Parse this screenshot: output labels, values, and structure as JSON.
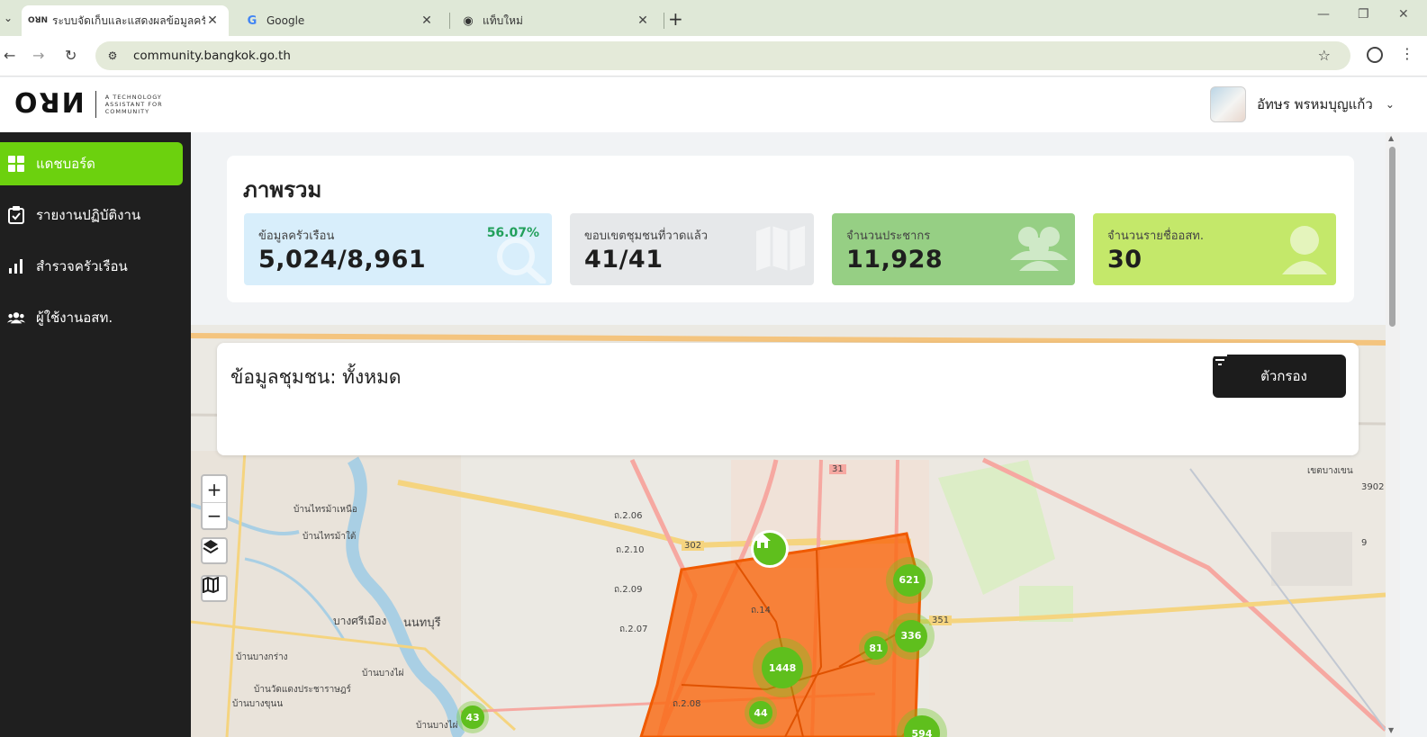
{
  "browser": {
    "tabs": [
      {
        "title": "ระบบจัดเก็บและแสดงผลข้อมูลครัวเรือน",
        "favicon": "OꓤN",
        "active": true
      },
      {
        "title": "Google",
        "favicon": "G",
        "active": false
      },
      {
        "title": "แท็บใหม่",
        "favicon": "◉",
        "active": false
      }
    ],
    "url": "community.bangkok.go.th",
    "new_tab": "+",
    "controls": {
      "minimize": "—",
      "restore": "❐",
      "close": "✕"
    }
  },
  "header": {
    "logo_mark": "OꓤИ",
    "logo_tagline": [
      "A TECHNOLOGY",
      "ASSISTANT FOR",
      "COMMUNITY"
    ],
    "user_name": "อัทษร พรหมบุญแก้ว"
  },
  "sidebar": {
    "items": [
      {
        "label": "แดชบอร์ด",
        "icon": "dashboard-icon",
        "active": true
      },
      {
        "label": "รายงานปฏิบัติงาน",
        "icon": "clipboard-check-icon",
        "active": false
      },
      {
        "label": "สำรวจครัวเรือน",
        "icon": "bar-chart-icon",
        "active": false
      },
      {
        "label": "ผู้ใช้งานอสท.",
        "icon": "users-icon",
        "active": false
      }
    ]
  },
  "overview": {
    "title": "ภาพรวม",
    "stats": [
      {
        "label": "ข้อมูลครัวเรือน",
        "value": "5,024/8,961",
        "percent": "56.07%",
        "color": "#d8eefb",
        "icon": "search-icon"
      },
      {
        "label": "ขอบเขตชุมชนที่วาดแล้ว",
        "value": "41/41",
        "color": "#e6e8ea",
        "icon": "map-icon"
      },
      {
        "label": "จำนวนประชากร",
        "value": "11,928",
        "color": "#96cf84",
        "icon": "people-icon"
      },
      {
        "label": "จำนวนรายชื่ออสท.",
        "value": "30",
        "color": "#c4e86a",
        "icon": "person-icon"
      }
    ]
  },
  "map": {
    "panel_title": "ข้อมูลชุมชน: ทั้งหมด",
    "filter_label": "ตัวกรอง",
    "zoom_in": "+",
    "zoom_out": "−",
    "clusters": [
      "621",
      "336",
      "81",
      "1448",
      "44",
      "43",
      "594"
    ],
    "labels": [
      "บ้านไทรม้าเหนือ",
      "บ้านไทรม้าใต้",
      "บางศรีเมือง",
      "นนทบุรี",
      "บ้านบางกร่าง",
      "บ้านบางไผ่",
      "บ้านวัดแดงประชาราษฎร์",
      "บ้านบางขุนน",
      "บ้านบางไผ่",
      "เขตบางเขน",
      "302",
      "31",
      "351",
      "3902",
      "9",
      "ถ.2.06",
      "ถ.2.10",
      "ถ.2.09",
      "ถ.2.07",
      "ถ.2.08",
      "ถ.14"
    ]
  }
}
